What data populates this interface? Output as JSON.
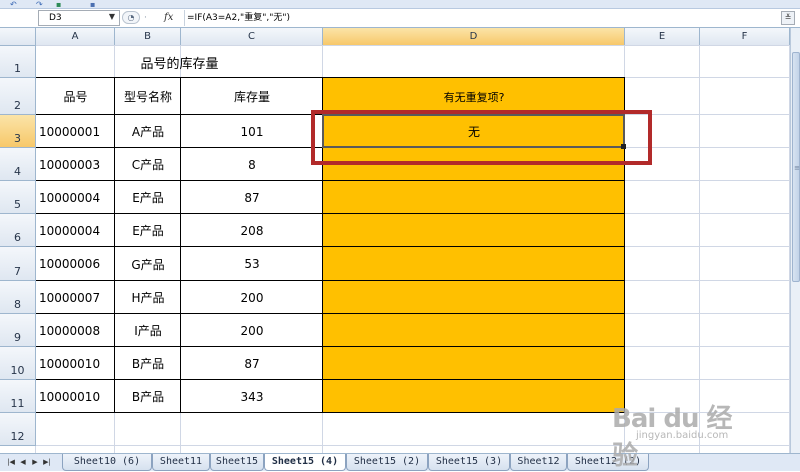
{
  "formula_bar": {
    "name_box": "D3",
    "fx": "fx",
    "formula": "=IF(A3=A2,\"重复\",\"无\")"
  },
  "columns": [
    "A",
    "B",
    "C",
    "D",
    "E",
    "F"
  ],
  "rows": [
    "1",
    "2",
    "3",
    "4",
    "5",
    "6",
    "7",
    "8",
    "9",
    "10",
    "11",
    "12"
  ],
  "sheet": {
    "title": "品号的库存量",
    "headers": {
      "col_a": "品号",
      "col_b": "型号名称",
      "col_c": "库存量",
      "col_d": "有无重复项?"
    },
    "records": [
      {
        "id": "10000001",
        "model": "A产品",
        "qty": "101",
        "dup": "无"
      },
      {
        "id": "10000003",
        "model": "C产品",
        "qty": "8",
        "dup": ""
      },
      {
        "id": "10000004",
        "model": "E产品",
        "qty": "87",
        "dup": ""
      },
      {
        "id": "10000004",
        "model": "E产品",
        "qty": "208",
        "dup": ""
      },
      {
        "id": "10000006",
        "model": "G产品",
        "qty": "53",
        "dup": ""
      },
      {
        "id": "10000007",
        "model": "H产品",
        "qty": "200",
        "dup": ""
      },
      {
        "id": "10000008",
        "model": "I产品",
        "qty": "200",
        "dup": ""
      },
      {
        "id": "10000010",
        "model": "B产品",
        "qty": "87",
        "dup": ""
      },
      {
        "id": "10000010",
        "model": "B产品",
        "qty": "343",
        "dup": ""
      }
    ]
  },
  "tabs": [
    "Sheet10 (6)",
    "Sheet11",
    "Sheet15",
    "Sheet15 (4)",
    "Sheet15 (2)",
    "Sheet15 (3)",
    "Sheet12",
    "Sheet12 (2)"
  ],
  "active_tab": "Sheet15 (4)",
  "watermark": {
    "brand": "Bai du 经验",
    "sub": "jingyan.baidu.com"
  },
  "colors": {
    "highlight_fill": "#ffc000",
    "annotation_box": "#b22a2a",
    "active_header": "#f7c86a"
  },
  "icons": [
    "undo-icon",
    "redo-icon",
    "fx-icon",
    "sheet-nav-first-icon",
    "sheet-nav-prev-icon",
    "sheet-nav-next-icon",
    "sheet-nav-last-icon"
  ]
}
